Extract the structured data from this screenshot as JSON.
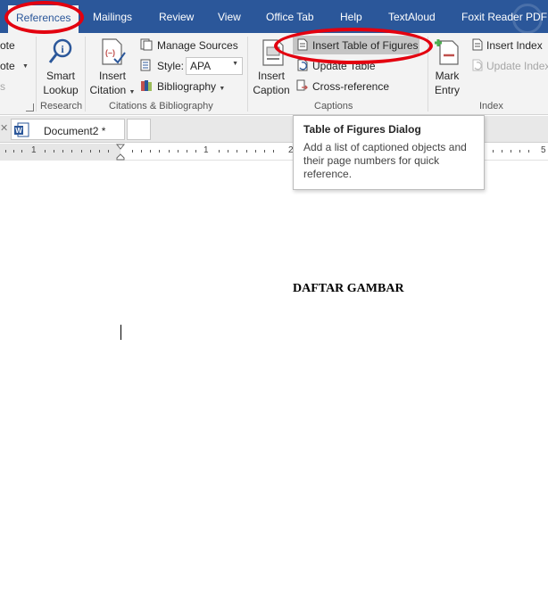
{
  "tabs": {
    "references": "References",
    "mailings": "Mailings",
    "review": "Review",
    "view": "View",
    "office_tab": "Office Tab",
    "help": "Help",
    "textaloud": "TextAloud",
    "foxit": "Foxit Reader PDF"
  },
  "ribbon": {
    "footnote_partial_1": "ote",
    "footnote_partial_2": "ote",
    "footnote_partial_3": "s",
    "research": {
      "smart_lookup_1": "Smart",
      "smart_lookup_2": "Lookup",
      "group_label": "Research"
    },
    "citations": {
      "insert_citation_1": "Insert",
      "insert_citation_2": "Citation",
      "manage_sources": "Manage Sources",
      "style_label": "Style:",
      "style_value": "APA",
      "bibliography": "Bibliography",
      "group_label": "Citations & Bibliography"
    },
    "captions": {
      "insert_caption_1": "Insert",
      "insert_caption_2": "Caption",
      "insert_table_of_figures": "Insert Table of Figures",
      "update_table": "Update Table",
      "cross_reference": "Cross-reference",
      "group_label": "Captions"
    },
    "index": {
      "mark_entry_1": "Mark",
      "mark_entry_2": "Entry",
      "insert_index": "Insert Index",
      "update_index": "Update Index",
      "group_label": "Index"
    }
  },
  "tooltip": {
    "title": "Table of Figures Dialog",
    "body": "Add a list of captioned objects and their page numbers for quick reference."
  },
  "document": {
    "tab_label": "Document2 *",
    "heading": "DAFTAR GAMBAR"
  },
  "ruler": {
    "n1": "1",
    "n2": "1",
    "n3": "2",
    "n5": "5"
  },
  "colors": {
    "tab_bar": "#2b579a",
    "ribbon_bg": "#f3f3f3",
    "annotation_red": "#e3000f"
  }
}
